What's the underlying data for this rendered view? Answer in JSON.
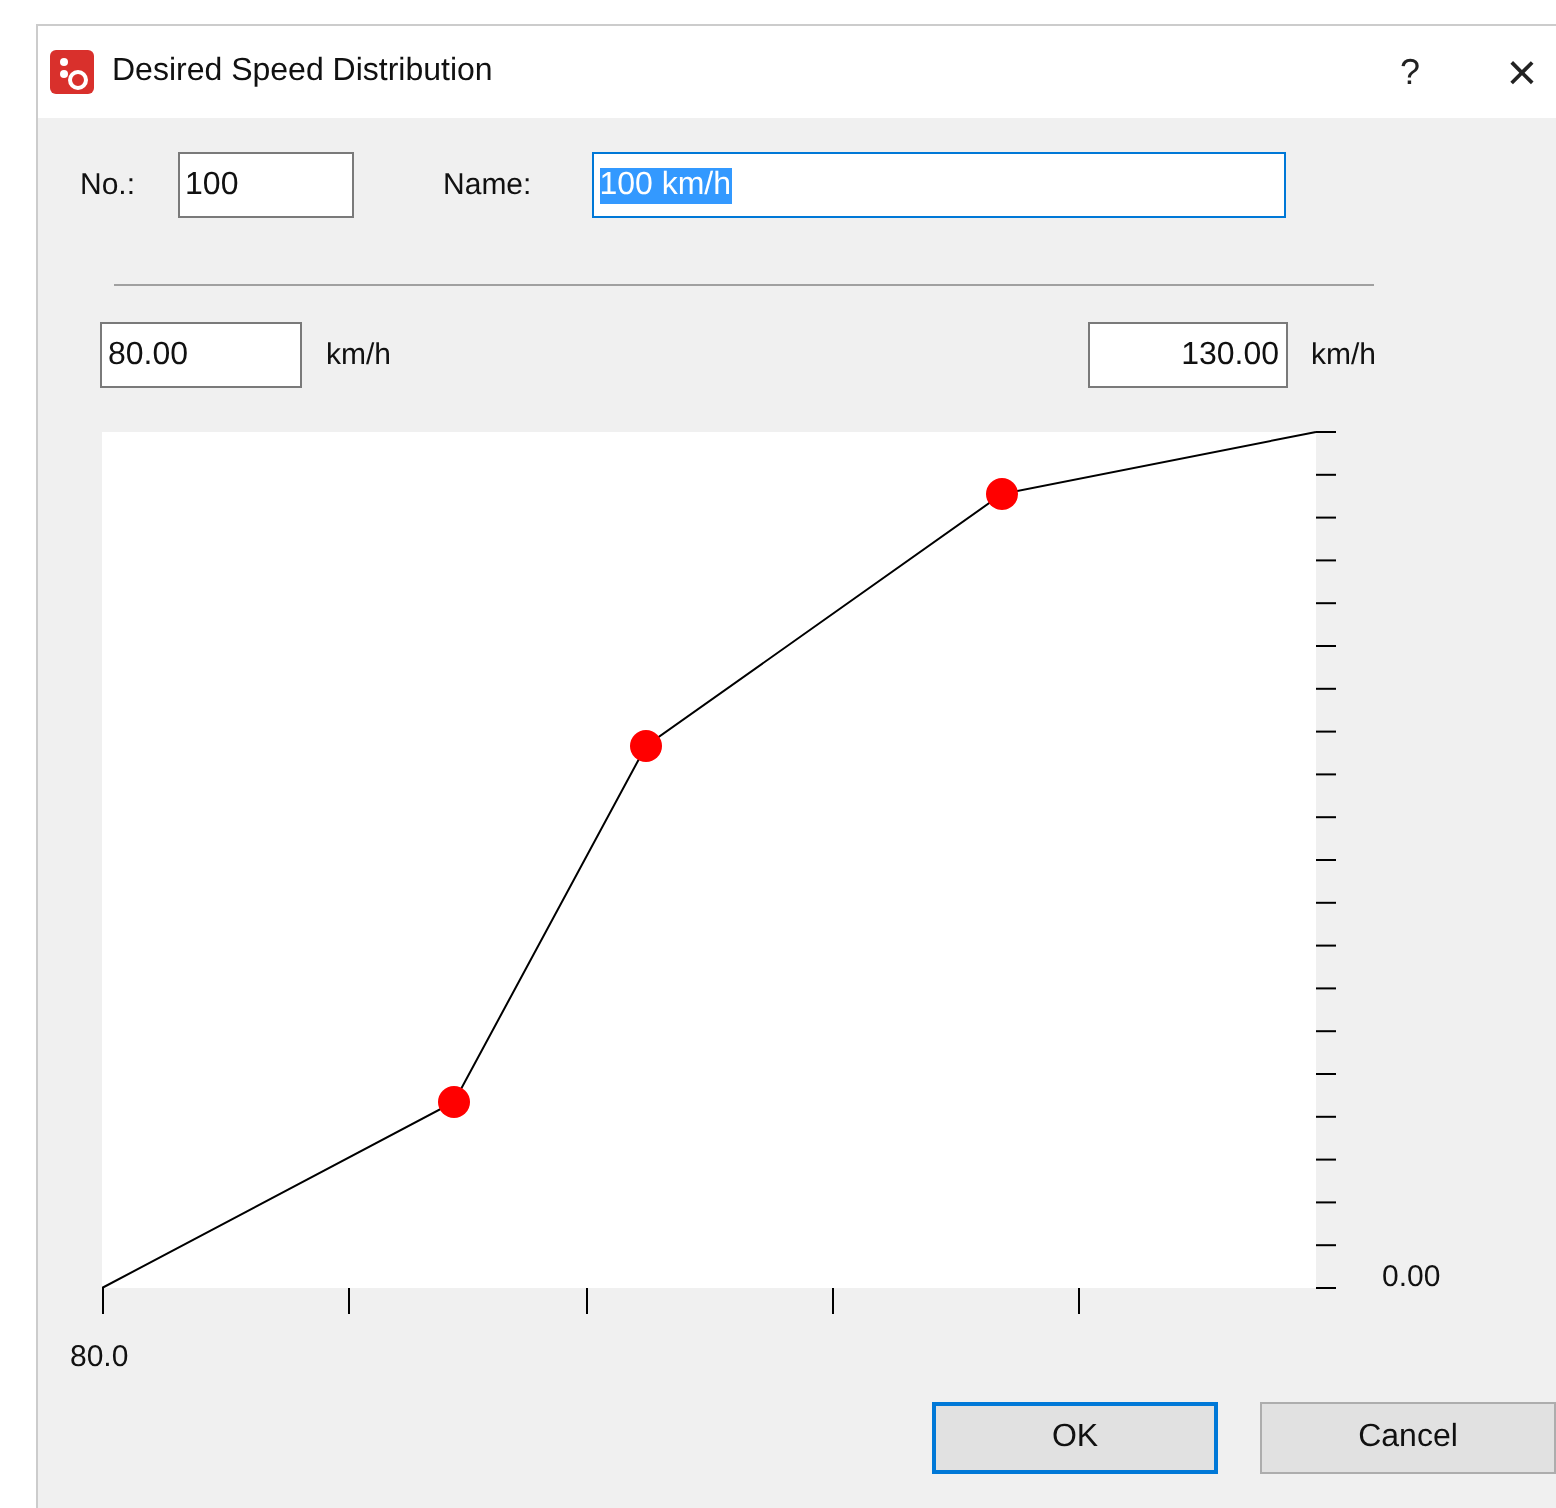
{
  "window": {
    "title": "Desired Speed Distribution",
    "help": "?",
    "close": "×"
  },
  "number": {
    "label": "No.:",
    "value": "100"
  },
  "name": {
    "label": "Name:",
    "value": "100 km/h",
    "selected": true
  },
  "range": {
    "min": "80.00",
    "min_unit": "km/h",
    "max": "130.00",
    "max_unit": "km/h"
  },
  "plot": {
    "x_label": "80.0",
    "y_label": "0.00"
  },
  "buttons": [
    {
      "label": "OK",
      "default": true
    },
    {
      "label": "Cancel",
      "default": false
    }
  ]
}
